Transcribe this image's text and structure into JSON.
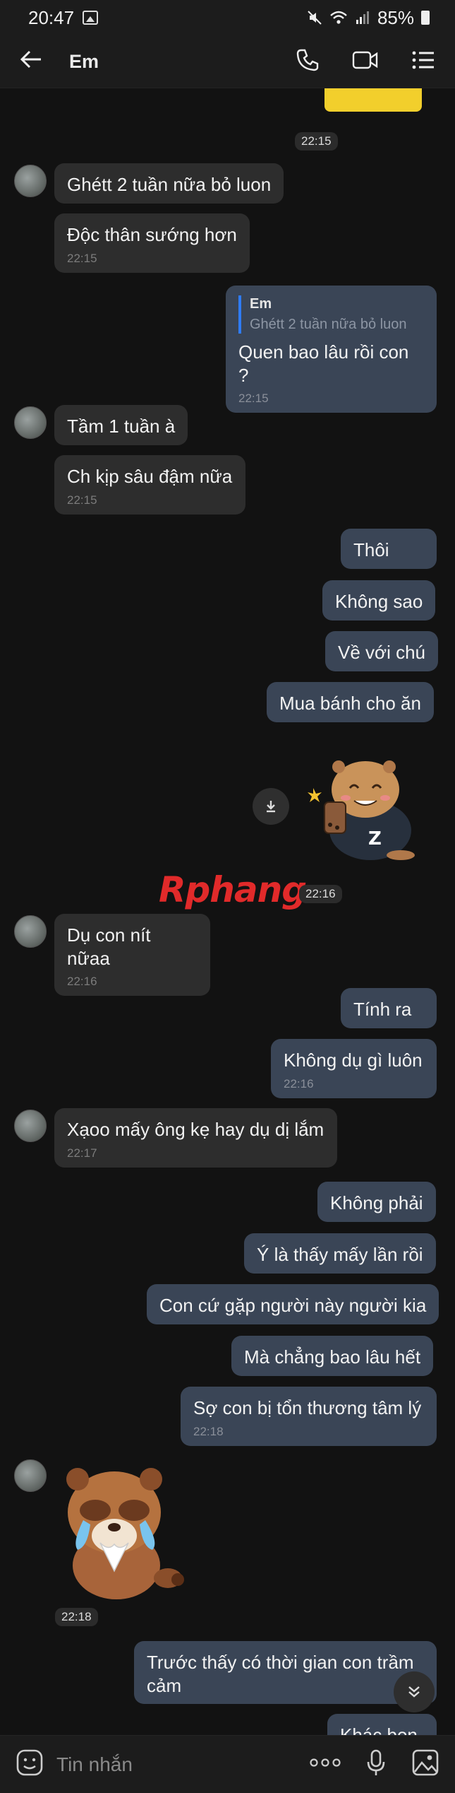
{
  "status_bar": {
    "time": "20:47",
    "battery": "85%"
  },
  "header": {
    "title": "Em"
  },
  "messages": {
    "t1": "22:15",
    "m1": {
      "text": "Ghétt 2 tuần nữa bỏ luon"
    },
    "m2": {
      "text": "Độc thân sướng hơn",
      "time": "22:15"
    },
    "m3": {
      "reply_name": "Em",
      "reply_text": "Ghétt 2 tuần nữa bỏ luon",
      "text": "Quen bao lâu rồi con ?",
      "time": "22:15"
    },
    "m4": {
      "text": "Tầm 1 tuần à"
    },
    "m5": {
      "text": "Ch kịp sâu đậm nữa",
      "time": "22:15"
    },
    "m6": {
      "text": "Thôi"
    },
    "m7": {
      "text": "Không sao"
    },
    "m8": {
      "text": "Về với chú"
    },
    "m9": {
      "text": "Mua bánh cho ăn"
    },
    "sticker1_time": "22:16",
    "m10": {
      "text": "Dụ con nít nữaa",
      "time": "22:16"
    },
    "m11": {
      "text": "Tính ra"
    },
    "m12": {
      "text": "Không dụ gì luôn",
      "time": "22:16"
    },
    "m13": {
      "text": "Xạoo mấy ông kẹ hay dụ dị lắm",
      "time": "22:17"
    },
    "m14": {
      "text": "Không phải"
    },
    "m15": {
      "text": "Ý là thấy mấy lần rồi"
    },
    "m16": {
      "text": "Con cứ gặp người này người kia"
    },
    "m17": {
      "text": "Mà chẳng bao lâu hết"
    },
    "m18": {
      "text": "Sợ con bị tổn thương tâm lý",
      "time": "22:18"
    },
    "sticker2_time": "22:18",
    "m19": {
      "text": "Trước thấy có thời gian con trầm cảm"
    },
    "m20": {
      "text": "Khác bọn"
    }
  },
  "watermark": "Rphang",
  "composer": {
    "placeholder": "Tin nhắn"
  },
  "icons": [
    "back-arrow-icon",
    "phone-icon",
    "video-icon",
    "list-icon",
    "download-icon",
    "sticker-icon",
    "more-icon",
    "mic-icon",
    "image-icon",
    "chevron-down-icon"
  ]
}
